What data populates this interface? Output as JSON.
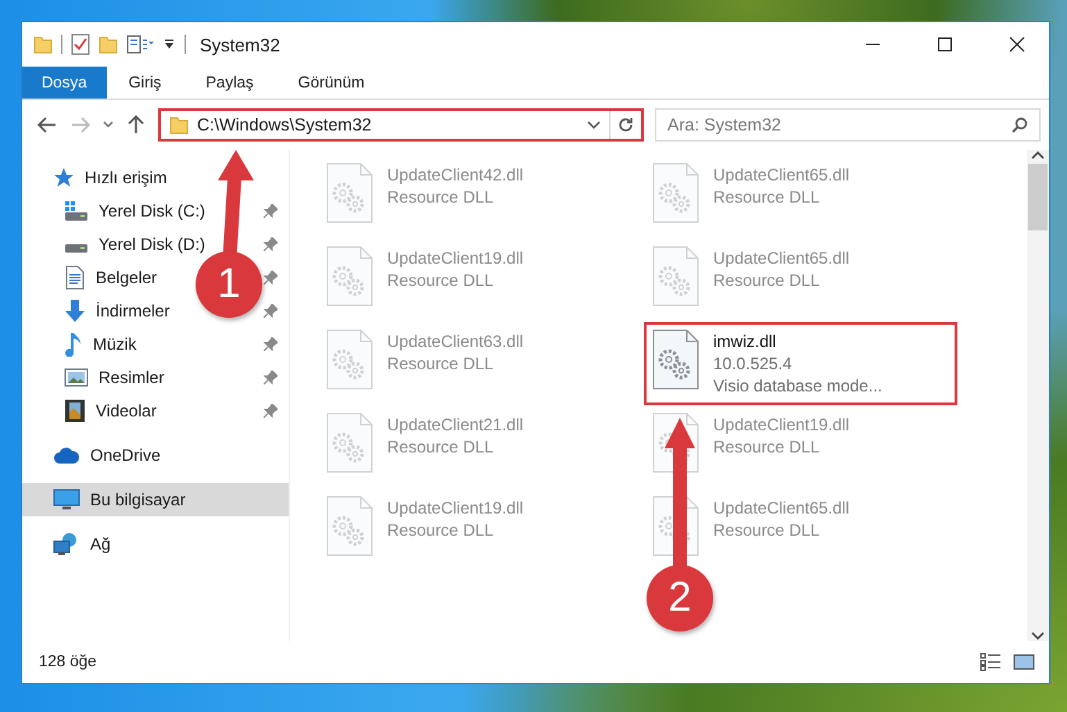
{
  "window": {
    "title": "System32"
  },
  "ribbon_tabs": [
    {
      "label": "Dosya",
      "selected": true
    },
    {
      "label": "Giriş",
      "selected": false
    },
    {
      "label": "Paylaş",
      "selected": false
    },
    {
      "label": "Görünüm",
      "selected": false
    }
  ],
  "address": {
    "path": "C:\\Windows\\System32",
    "highlighted": true
  },
  "search": {
    "placeholder": "Ara: System32"
  },
  "sidebar": {
    "items": [
      {
        "label": "Hızlı erişim",
        "kind": "star",
        "selected": false,
        "children": [
          {
            "label": "Yerel Disk (C:)",
            "kind": "drive-c",
            "selected": false,
            "pinned": true
          },
          {
            "label": "Yerel Disk (D:)",
            "kind": "drive",
            "selected": false,
            "pinned": true
          },
          {
            "label": "Belgeler",
            "kind": "document",
            "selected": false,
            "pinned": true
          },
          {
            "label": "İndirmeler",
            "kind": "download",
            "selected": false,
            "pinned": true
          },
          {
            "label": "Müzik",
            "kind": "music",
            "selected": false,
            "pinned": true
          },
          {
            "label": "Resimler",
            "kind": "picture",
            "selected": false,
            "pinned": true
          },
          {
            "label": "Videolar",
            "kind": "video",
            "selected": false,
            "pinned": true
          }
        ]
      },
      {
        "label": "OneDrive",
        "kind": "cloud",
        "selected": false
      },
      {
        "label": "Bu bilgisayar",
        "kind": "pc",
        "selected": true
      },
      {
        "label": "Ağ",
        "kind": "network",
        "selected": false
      }
    ]
  },
  "files": [
    {
      "name": "UpdateClient42.dll",
      "type": "Resource DLL",
      "faded": true,
      "highlighted": false
    },
    {
      "name": "UpdateClient65.dll",
      "type": "Resource DLL",
      "faded": true,
      "highlighted": false
    },
    {
      "name": "UpdateClient19.dll",
      "type": "Resource DLL",
      "faded": true,
      "highlighted": false
    },
    {
      "name": "UpdateClient65.dll",
      "type": "Resource DLL",
      "faded": true,
      "highlighted": false
    },
    {
      "name": "UpdateClient63.dll",
      "type": "Resource DLL",
      "faded": true,
      "highlighted": false
    },
    {
      "name": "imwiz.dll",
      "version": "10.0.525.4",
      "type": "Visio database mode...",
      "faded": false,
      "highlighted": true
    },
    {
      "name": "UpdateClient21.dll",
      "type": "Resource DLL",
      "faded": true,
      "highlighted": false
    },
    {
      "name": "UpdateClient19.dll",
      "type": "Resource DLL",
      "faded": true,
      "highlighted": false
    },
    {
      "name": "UpdateClient19.dll",
      "type": "Resource DLL",
      "faded": true,
      "highlighted": false
    },
    {
      "name": "UpdateClient65.dll",
      "type": "Resource DLL",
      "faded": true,
      "highlighted": false
    }
  ],
  "status_bar": {
    "item_count": "128 öğe"
  },
  "annotations": [
    {
      "label": "1"
    },
    {
      "label": "2"
    }
  ]
}
